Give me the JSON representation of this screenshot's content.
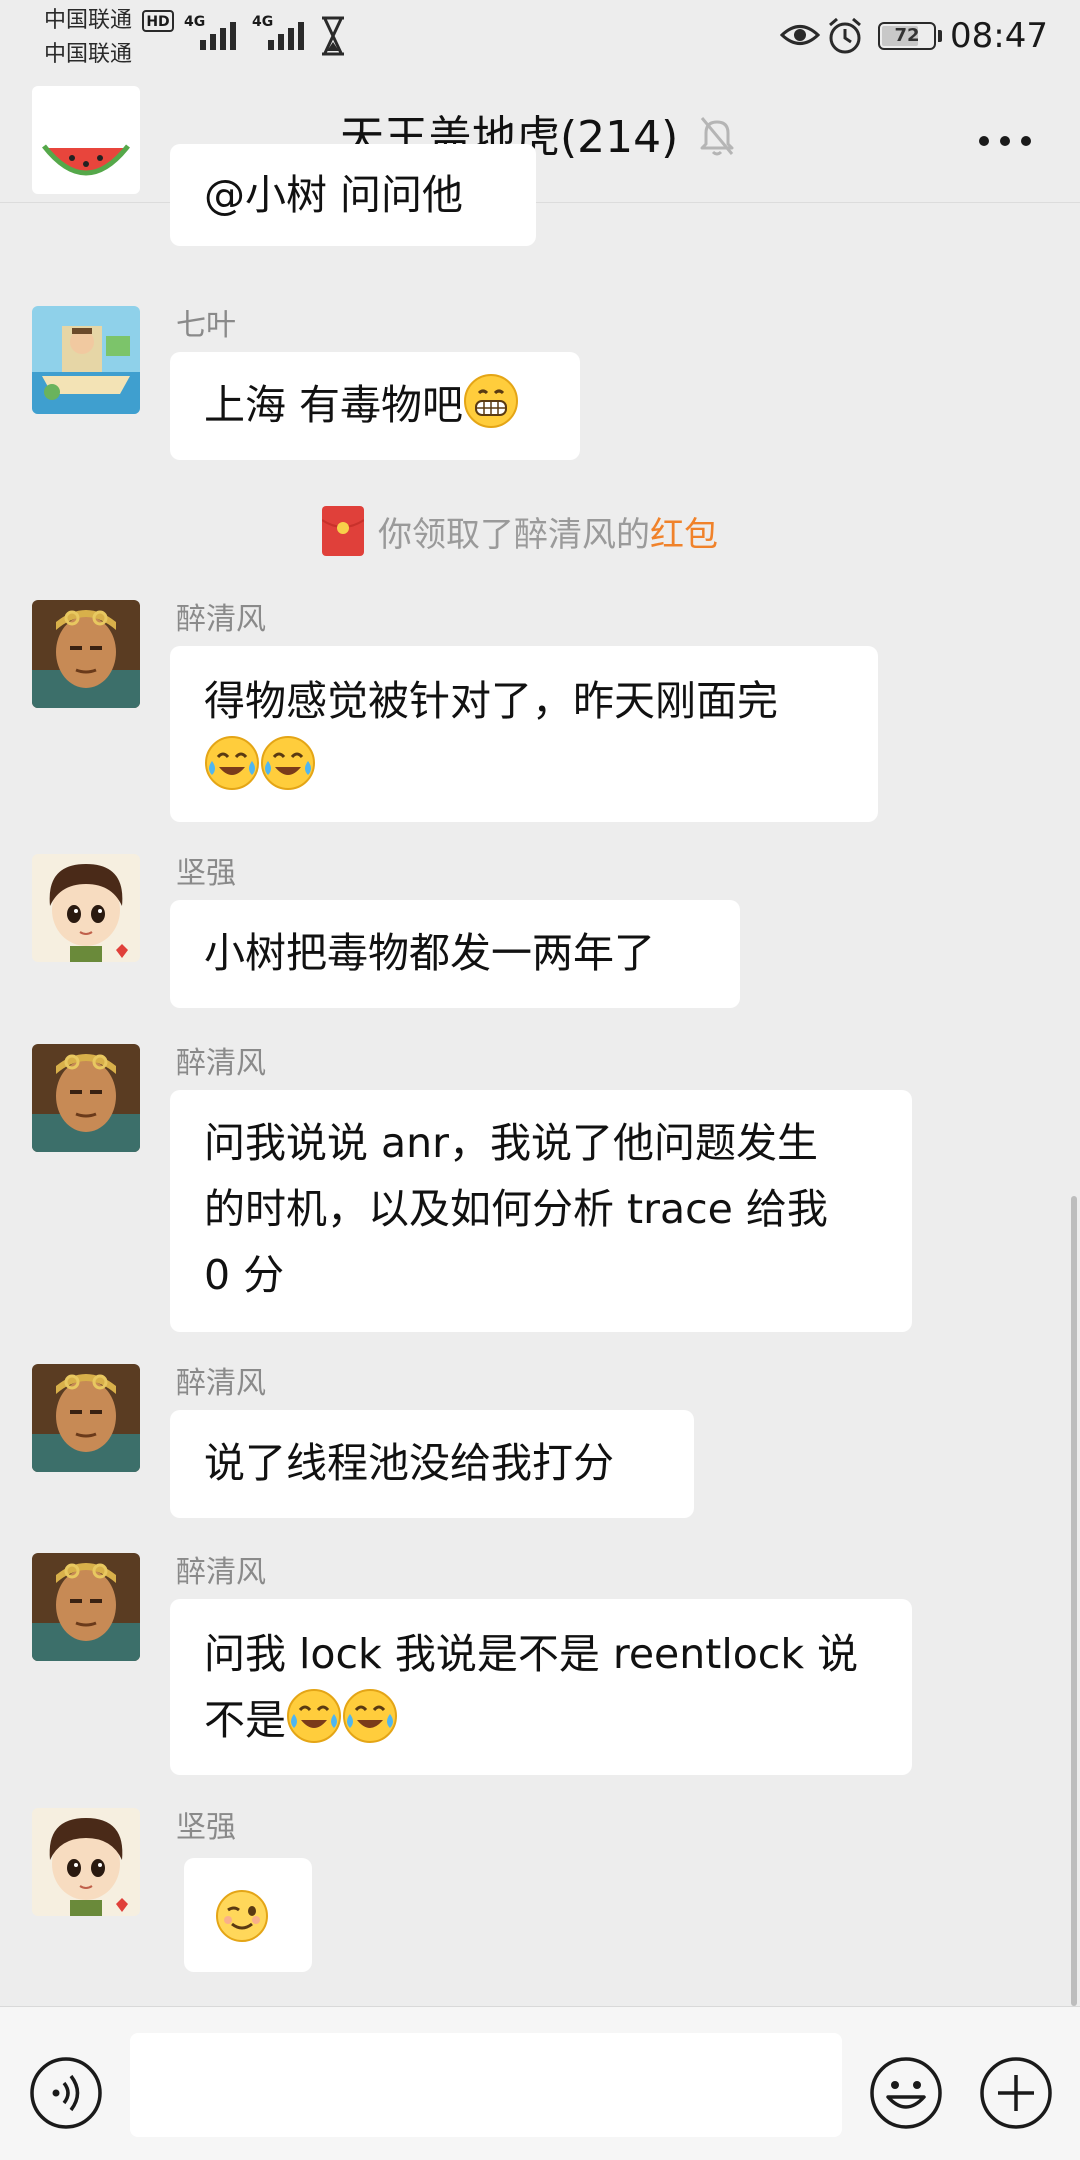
{
  "status_bar": {
    "carrier_1": "中国联通",
    "carrier_2": "中国联通",
    "hd_badge": "HD",
    "network_1": "4G",
    "network_2": "4G",
    "battery_percent": "72",
    "battery_level": 0.72,
    "time": "08:47"
  },
  "header": {
    "title": "天王盖地虎(214)",
    "back_icon": "chevron-left-icon",
    "mute_icon": "bell-off-icon",
    "more_icon": "more-dots-icon"
  },
  "messages": [
    {
      "sender": "",
      "text_lines": [
        "@小树  问问他"
      ],
      "avatar": "watermelon-avatar"
    },
    {
      "sender": "七叶",
      "text_lines": [
        "上海 有毒物吧"
      ],
      "emojis": [
        "grin-emoji"
      ],
      "avatar": "cartoon-boat-avatar"
    },
    {
      "sender": "醉清风",
      "text_lines": [
        "得物感觉被针对了，昨天刚面完",
        ""
      ],
      "emojis": [
        "crying-laugh-emoji",
        "crying-laugh-emoji"
      ],
      "avatar": "monkey-king-avatar"
    },
    {
      "sender": "坚强",
      "text_lines": [
        "小树把毒物都发一两年了"
      ],
      "avatar": "cartoon-boy-avatar"
    },
    {
      "sender": "醉清风",
      "text_lines": [
        "问我说说 anr，我说了他问题发生",
        "的时机，以及如何分析 trace 给我",
        "0 分"
      ],
      "avatar": "monkey-king-avatar"
    },
    {
      "sender": "醉清风",
      "text_lines": [
        "说了线程池没给我打分"
      ],
      "avatar": "monkey-king-avatar"
    },
    {
      "sender": "醉清风",
      "text_lines": [
        "问我 lock 我说是不是 reentlock 说",
        "不是"
      ],
      "emojis": [
        "crying-laugh-emoji",
        "crying-laugh-emoji"
      ],
      "avatar": "monkey-king-avatar"
    },
    {
      "sender": "坚强",
      "text_lines": [
        ""
      ],
      "emojis": [
        "wink-emoji"
      ],
      "avatar": "cartoon-boy-avatar"
    }
  ],
  "system_notice": {
    "prefix": "你领取了醉清风的",
    "link": "红包",
    "icon": "red-packet-icon"
  },
  "input_bar": {
    "voice_icon": "voice-icon",
    "emoji_icon": "smiley-icon",
    "plus_icon": "plus-circle-icon",
    "text_value": ""
  },
  "colors": {
    "background": "#ededed",
    "bubble": "#ffffff",
    "sender_text": "#8a8a8a",
    "link": "#f0822a",
    "red_packet": "#e0403a"
  }
}
